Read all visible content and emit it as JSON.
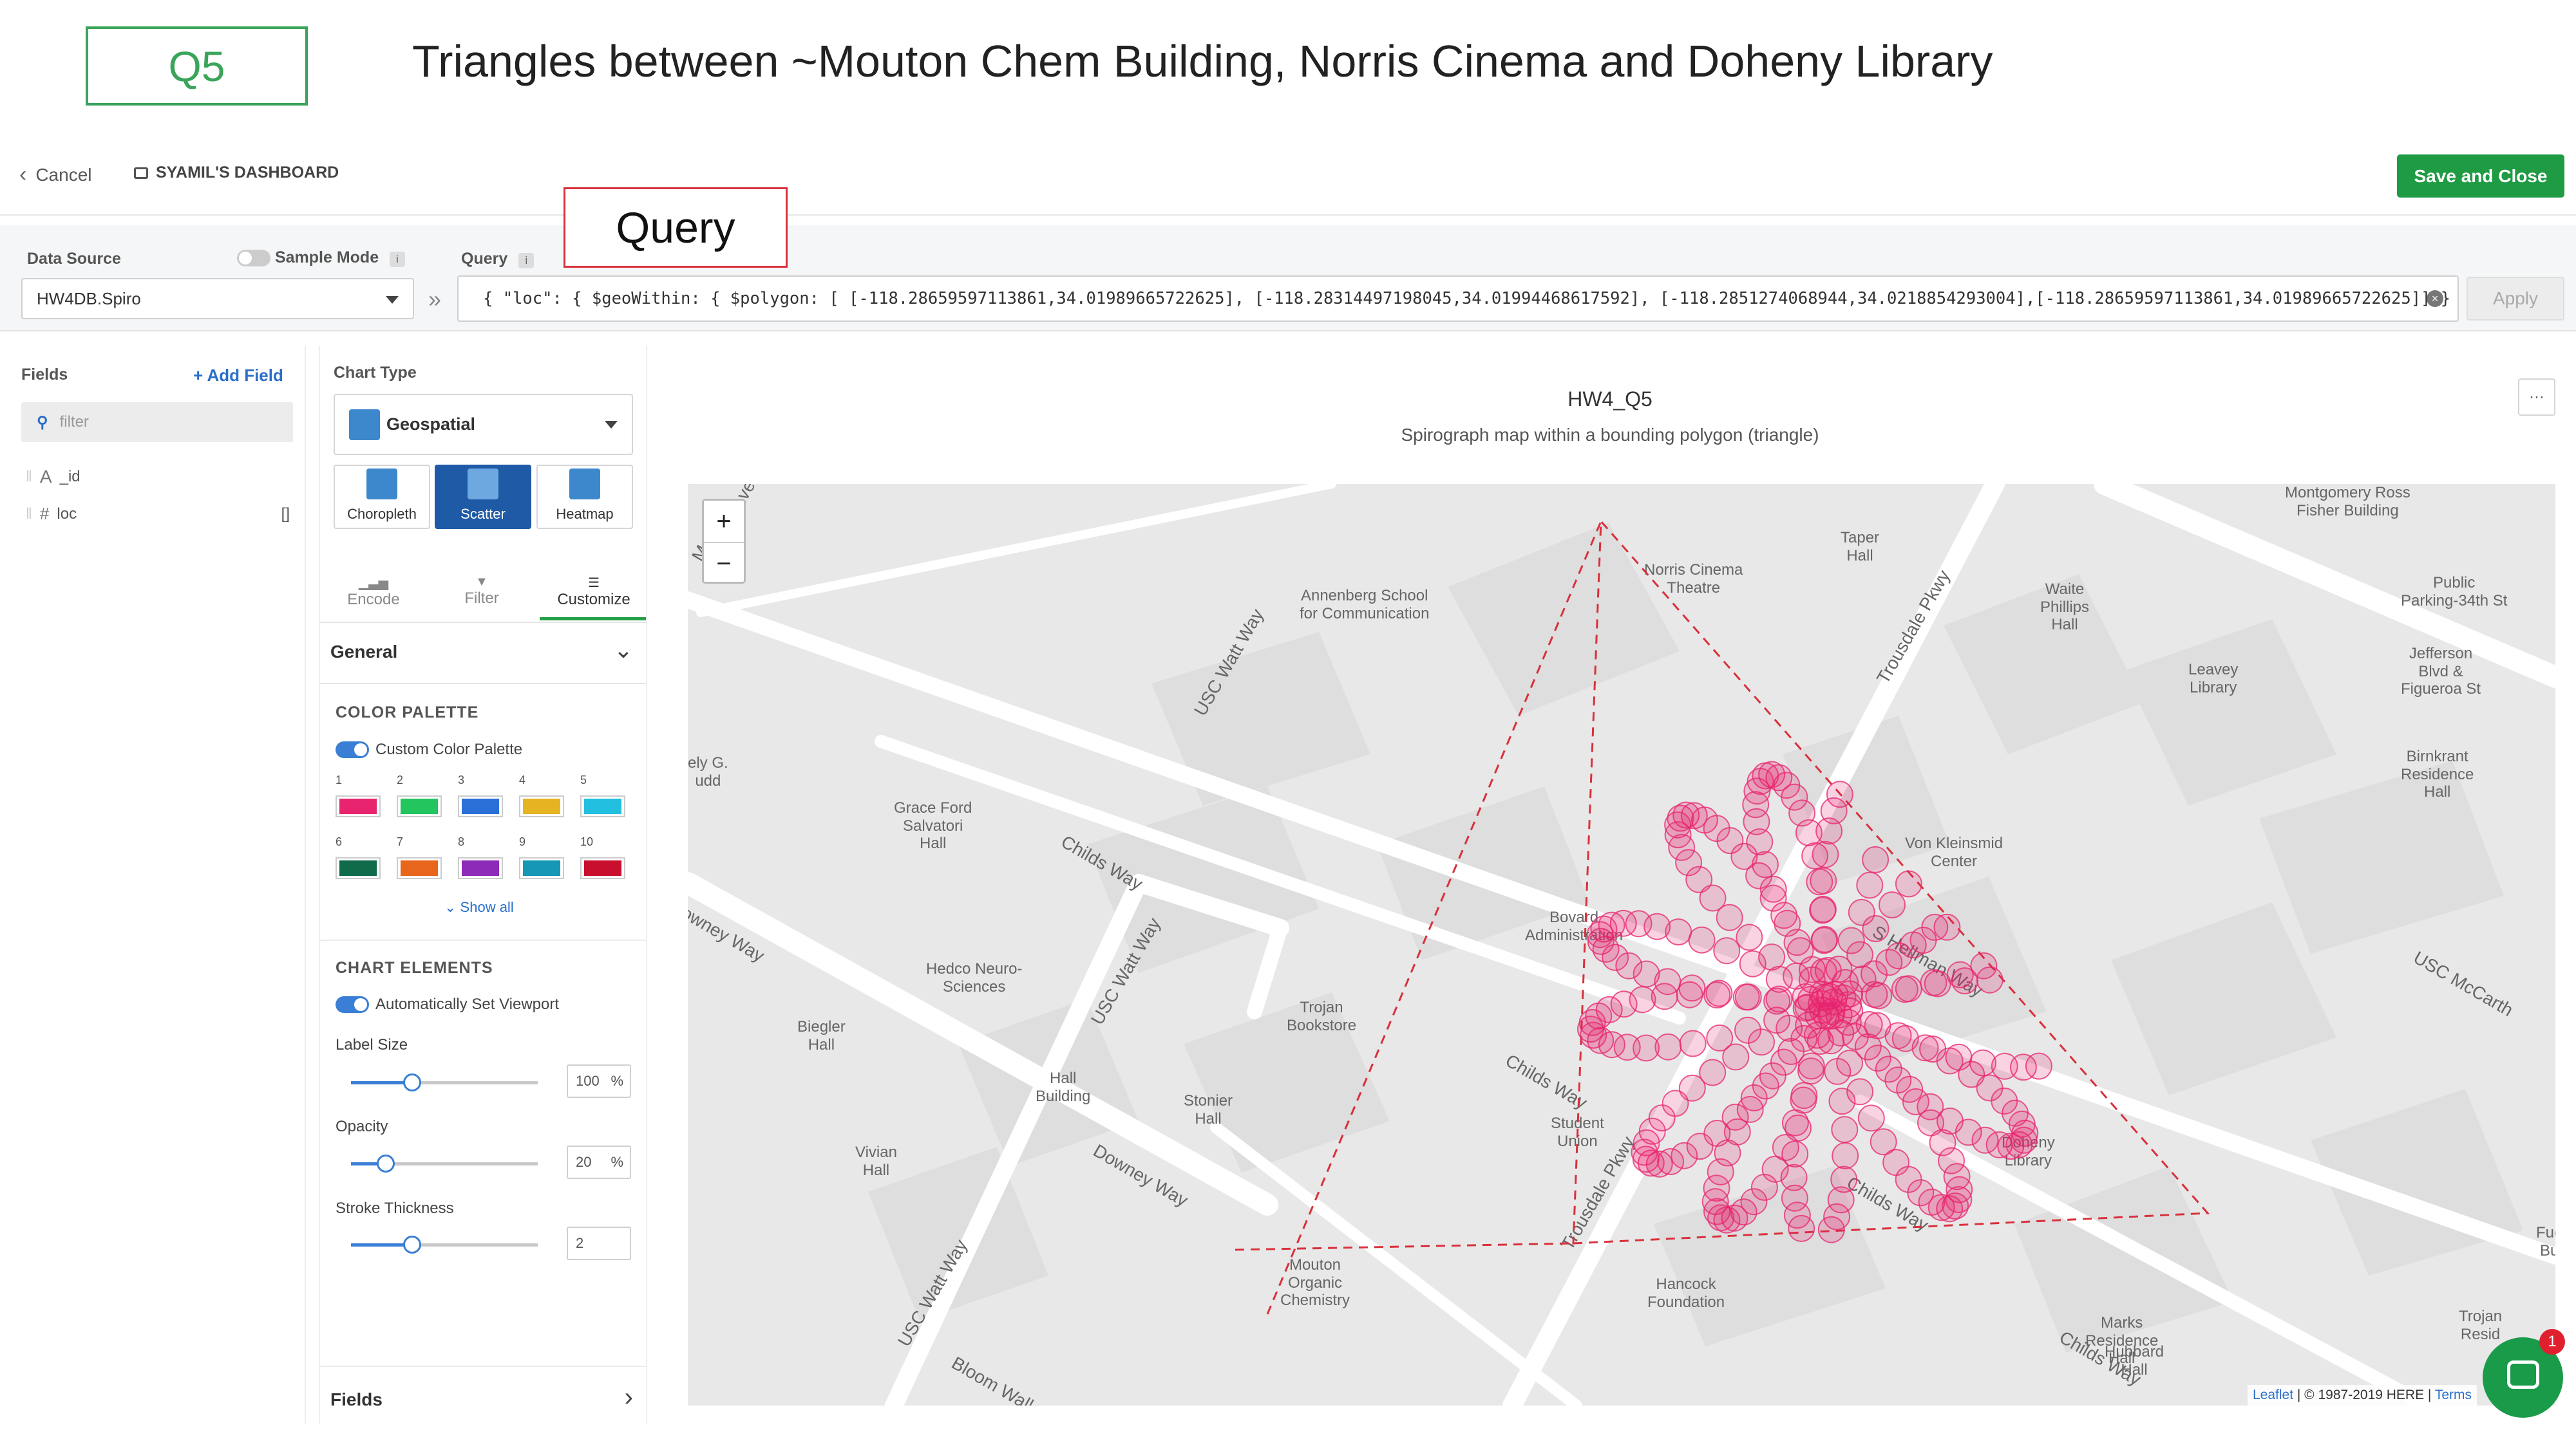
{
  "slide": {
    "tag": "Q5",
    "title": "Triangles between ~Mouton Chem Building, Norris Cinema and Doheny Library",
    "annotation": "Query"
  },
  "header": {
    "cancel_label": "Cancel",
    "dashboard_name": "SYAMIL'S DASHBOARD",
    "save_label": "Save and Close"
  },
  "source_bar": {
    "data_source_label": "Data Source",
    "sample_mode_label": "Sample Mode",
    "query_label": "Query",
    "data_source_value": "HW4DB.Spiro",
    "query_value": "{ \"loc\": { $geoWithin: { $polygon: [ [-118.28659597113861,34.01989665722625], [-118.28314497198045,34.01994468617592], [-118.2851274068944,34.0218854293004],[-118.28659597113861,34.01989665722625]] } }",
    "apply_label": "Apply",
    "info": "i"
  },
  "fields_panel": {
    "title": "Fields",
    "add_field_label": "+ Add Field",
    "filter_placeholder": "filter",
    "fields": [
      {
        "name": "_id",
        "type_icon": "A"
      },
      {
        "name": "loc",
        "type_icon": "#",
        "suffix": "[]"
      }
    ]
  },
  "chart_panel": {
    "chart_type_label": "Chart Type",
    "chart_type_value": "Geospatial",
    "subtypes": [
      "Choropleth",
      "Scatter",
      "Heatmap"
    ],
    "tabs": [
      "Encode",
      "Filter",
      "Customize"
    ],
    "general_label": "General",
    "color_palette_label": "COLOR PALETTE",
    "custom_palette_label": "Custom Color Palette",
    "palette": [
      {
        "n": "1",
        "color": "#e8246e"
      },
      {
        "n": "2",
        "color": "#22c55e"
      },
      {
        "n": "3",
        "color": "#2b6fd8"
      },
      {
        "n": "4",
        "color": "#e6b422"
      },
      {
        "n": "5",
        "color": "#22bfe0"
      },
      {
        "n": "6",
        "color": "#0f6b4a"
      },
      {
        "n": "7",
        "color": "#e8661c"
      },
      {
        "n": "8",
        "color": "#8e2ab8"
      },
      {
        "n": "9",
        "color": "#1597b5"
      },
      {
        "n": "10",
        "color": "#c8102e"
      }
    ],
    "show_all_label": "Show all",
    "chart_elements_label": "CHART ELEMENTS",
    "auto_viewport_label": "Automatically Set Viewport",
    "label_size_label": "Label Size",
    "label_size_value": "100",
    "opacity_label": "Opacity",
    "opacity_value": "20",
    "stroke_label": "Stroke Thickness",
    "stroke_value": "2",
    "percent": "%",
    "fields_section_label": "Fields"
  },
  "chart": {
    "title": "HW4_Q5",
    "subtitle": "Spirograph map within a bounding polygon (triangle)",
    "more_label": "···",
    "attribution_link": "Leaflet",
    "attribution_text": " | © 1987-2019 HERE | ",
    "attribution_terms": "Terms",
    "zoom_in": "+",
    "zoom_out": "−",
    "chat_badge": "1",
    "point_color": "#e8246e",
    "map_labels": [
      "Taper\nHall",
      "Norris Cinema\nTheatre",
      "Montgomery Ross\nFisher Building",
      "Public\nParking-34th St",
      "Annenberg School\nfor Communication",
      "Waite\nPhillips\nHall",
      "Leavey\nLibrary",
      "Jefferson\nBlvd &\nFigueroa St",
      "Birnkrant\nResidence\nHall",
      "Grace Ford\nSalvatori\nHall",
      "Von Kleinsmid\nCenter",
      "Bovard\nAdministration",
      "Hedco Neuro-\nSciences",
      "Trojan\nBookstore",
      "Biegler\nHall",
      "Hall\nBuilding",
      "Stonier\nHall",
      "Student\nUnion",
      "Doheny\nLibrary",
      "Vivian\nHall",
      "Mouton\nOrganic\nChemistry",
      "Hancock\nFoundation",
      "Marks\nResidence\nHall",
      "Hubbard\nHall",
      "Trojan\nResid",
      "Fug\nBu",
      "ely G.\nudd",
      "Childs Way",
      "Childs Way",
      "Childs Way",
      "Childs Way",
      "Downey Way",
      "owney Way",
      "USC Watt Way",
      "USC Watt Way",
      "USC Watt Way",
      "Trousdale Pkwy",
      "Trousdale Pkwy",
      "S Hellman Way",
      "USC McCarth",
      "Bloom Walk",
      "Ave",
      "McC"
    ]
  }
}
